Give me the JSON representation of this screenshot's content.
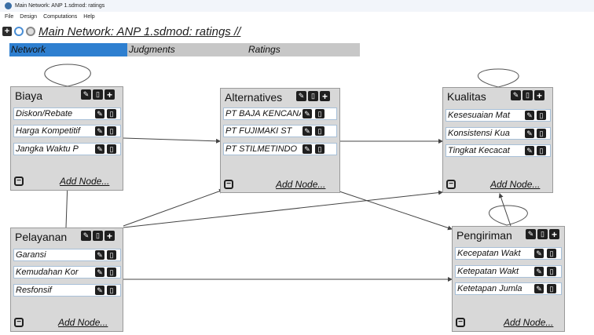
{
  "window": {
    "title": "Main Network: ANP 1.sdmod: ratings"
  },
  "menu": [
    "File",
    "Design",
    "Computations",
    "Help"
  ],
  "nav": {
    "path": "Main Network: ANP 1.sdmod: ratings //"
  },
  "tabs": [
    {
      "label": "Network",
      "active": true
    },
    {
      "label": "Judgments",
      "active": false
    },
    {
      "label": "Ratings",
      "active": false
    }
  ],
  "add_node_label": "Add Node...",
  "nodes": {
    "biaya": {
      "title": "Biaya",
      "items": [
        "Diskon/Rebate",
        "Harga Kompetitif",
        "Jangka Waktu P"
      ]
    },
    "alternatives": {
      "title": "Alternatives",
      "items": [
        "PT BAJA KENCANA",
        "PT FUJIMAKI ST",
        "PT STILMETINDO"
      ]
    },
    "kualitas": {
      "title": "Kualitas",
      "items": [
        "Kesesuaian Mat",
        "Konsistensi Kua",
        "Tingkat Kecacat"
      ]
    },
    "pelayanan": {
      "title": "Pelayanan",
      "items": [
        "Garansi",
        "Kemudahan Kor",
        "Resfonsif"
      ]
    },
    "pengiriman": {
      "title": "Pengiriman",
      "items": [
        "Kecepatan Wakt",
        "Ketepatan Wakt",
        "Ketetapan Jumla"
      ]
    }
  },
  "colors": {
    "active_tab": "#2e7fd0",
    "tab_bar": "#c7c7c7",
    "node_bg": "#d8d8d8",
    "row_border": "#a8c0d8"
  }
}
